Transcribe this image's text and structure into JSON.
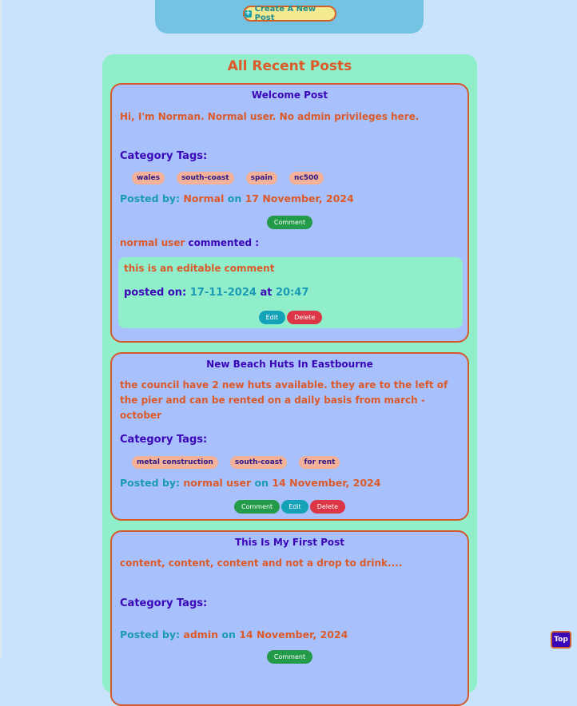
{
  "header": {
    "create_post_label": "Create A New Post",
    "create_icon": "plus-square-icon"
  },
  "feed": {
    "title": "All Recent Posts"
  },
  "labels": {
    "category_tags": "Category Tags:",
    "posted_by": "Posted by:",
    "on": "on",
    "commented": "commented :",
    "posted_on": "posted on:",
    "at": "at",
    "comment": "Comment",
    "edit": "Edit",
    "delete": "Delete"
  },
  "posts": [
    {
      "title": "Welcome Post",
      "body": "Hi, I'm Norman. Normal user. No admin privileges here.",
      "tags": [
        "wales",
        "south-coast",
        "spain",
        "nc500"
      ],
      "author": "Normal",
      "date": "17 November, 2024",
      "comments": [
        {
          "author": "normal user",
          "text": "this is an editable comment",
          "date": "17-11-2024",
          "time": "20:47"
        }
      ]
    },
    {
      "title": "New Beach Huts In Eastbourne",
      "body": "the council have 2 new huts available. they are to the left of the pier and can be rented on a daily basis from march -october",
      "tags": [
        "metal construction",
        "south-coast",
        "for rent"
      ],
      "author": "normal user",
      "date": "14 November, 2024"
    },
    {
      "title": "This Is My First Post",
      "body": "content, content, content and not a drop to drink....",
      "tags": [],
      "author": "admin",
      "date": "14 November, 2024"
    }
  ],
  "scroll_top_label": "Top",
  "colors": {
    "page_bg": "#c8e3fb",
    "feed_bg": "#90eecb",
    "post_bg": "#a8c0fb",
    "accent_orange": "#dc5a2a",
    "accent_purple": "#3b06b8",
    "accent_cyan": "#1a9bb3",
    "comment_green": "#239b48",
    "delete_red": "#dc3545"
  }
}
